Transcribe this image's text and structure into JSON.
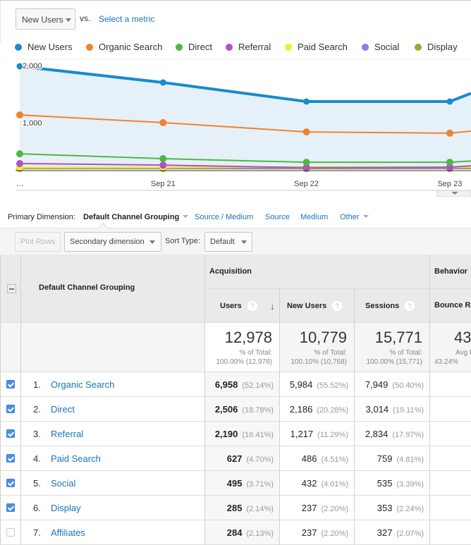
{
  "controls": {
    "metric_select": "New Users",
    "vs_label": "vs.",
    "select_metric_link": "Select a metric"
  },
  "legend": [
    {
      "label": "New Users",
      "color": "#1a8bcb"
    },
    {
      "label": "Organic Search",
      "color": "#f0832c"
    },
    {
      "label": "Direct",
      "color": "#4cb940"
    },
    {
      "label": "Referral",
      "color": "#b34fc8"
    },
    {
      "label": "Paid Search",
      "color": "#eeee33"
    },
    {
      "label": "Social",
      "color": "#7f7ff0"
    },
    {
      "label": "Display",
      "color": "#a3a32e"
    }
  ],
  "chart_data": {
    "type": "line",
    "title": "",
    "xlabel": "",
    "ylabel": "",
    "x": [
      "…",
      "Sep 21",
      "Sep 22",
      "Sep 23"
    ],
    "y_ticks": [
      "2,000",
      "1,000"
    ],
    "ylim": [
      0,
      2000
    ],
    "grid": true,
    "series": [
      {
        "name": "New Users",
        "color": "#1a8bcb",
        "values": [
          2000,
          1685,
          1315,
          1315
        ],
        "area": true
      },
      {
        "name": "Organic Search",
        "color": "#f0832c",
        "values": [
          1055,
          905,
          725,
          700
        ]
      },
      {
        "name": "Direct",
        "color": "#4cb940",
        "values": [
          300,
          205,
          135,
          135
        ]
      },
      {
        "name": "Referral",
        "color": "#b34fc8",
        "values": [
          110,
          80,
          30,
          40
        ]
      },
      {
        "name": "Paid Search",
        "color": "#eeee33",
        "values": [
          35,
          35,
          45,
          40
        ]
      },
      {
        "name": "Social",
        "color": "#7f7ff0",
        "values": [
          30,
          28,
          25,
          28
        ]
      },
      {
        "name": "Display",
        "color": "#a3a32e",
        "values": [
          12,
          12,
          10,
          12
        ]
      }
    ]
  },
  "dimension_bar": {
    "label": "Primary Dimension:",
    "active": "Default Channel Grouping",
    "links": [
      "Source / Medium",
      "Source",
      "Medium",
      "Other"
    ]
  },
  "toolbar": {
    "plot_rows": "Plot Rows",
    "secondary_dimension": "Secondary dimension",
    "sort_type_label": "Sort Type:",
    "sort_type_value": "Default"
  },
  "table": {
    "group_headers": {
      "acquisition": "Acquisition",
      "behavior": "Behavior"
    },
    "dimension_header": "Default Channel Grouping",
    "columns": {
      "users": "Users",
      "new_users": "New Users",
      "sessions": "Sessions",
      "bounce_rate": "Bounce Ra"
    },
    "help_glyph": "?",
    "sort_glyph": "↓",
    "totals": {
      "users": {
        "value": "12,978",
        "line1": "% of Total:",
        "line2": "100.00% (12,978)"
      },
      "new_users": {
        "value": "10,779",
        "line1": "% of Total:",
        "line2": "100.10% (10,768)"
      },
      "sessions": {
        "value": "15,771",
        "line1": "% of Total:",
        "line2": "100.00% (15,771)"
      },
      "bounce_rate": {
        "value": "43.",
        "line1": "Avg f",
        "line2": "43.24%"
      }
    },
    "rows": [
      {
        "checked": true,
        "index": "1.",
        "name": "Organic Search",
        "users": "6,958",
        "users_pct": "(52.14%)",
        "new_users": "5,984",
        "new_users_pct": "(55.52%)",
        "sessions": "7,949",
        "sessions_pct": "(50.40%)"
      },
      {
        "checked": true,
        "index": "2.",
        "name": "Direct",
        "users": "2,506",
        "users_pct": "(18.78%)",
        "new_users": "2,186",
        "new_users_pct": "(20.28%)",
        "sessions": "3,014",
        "sessions_pct": "(19.11%)"
      },
      {
        "checked": true,
        "index": "3.",
        "name": "Referral",
        "users": "2,190",
        "users_pct": "(16.41%)",
        "new_users": "1,217",
        "new_users_pct": "(11.29%)",
        "sessions": "2,834",
        "sessions_pct": "(17.97%)"
      },
      {
        "checked": true,
        "index": "4.",
        "name": "Paid Search",
        "users": "627",
        "users_pct": "(4.70%)",
        "new_users": "486",
        "new_users_pct": "(4.51%)",
        "sessions": "759",
        "sessions_pct": "(4.81%)"
      },
      {
        "checked": true,
        "index": "5.",
        "name": "Social",
        "users": "495",
        "users_pct": "(3.71%)",
        "new_users": "432",
        "new_users_pct": "(4.01%)",
        "sessions": "535",
        "sessions_pct": "(3.39%)"
      },
      {
        "checked": true,
        "index": "6.",
        "name": "Display",
        "users": "285",
        "users_pct": "(2.14%)",
        "new_users": "237",
        "new_users_pct": "(2.20%)",
        "sessions": "353",
        "sessions_pct": "(2.24%)"
      },
      {
        "checked": false,
        "index": "7.",
        "name": "Affiliates",
        "users": "284",
        "users_pct": "(2.13%)",
        "new_users": "237",
        "new_users_pct": "(2.20%)",
        "sessions": "327",
        "sessions_pct": "(2.07%)"
      }
    ]
  }
}
